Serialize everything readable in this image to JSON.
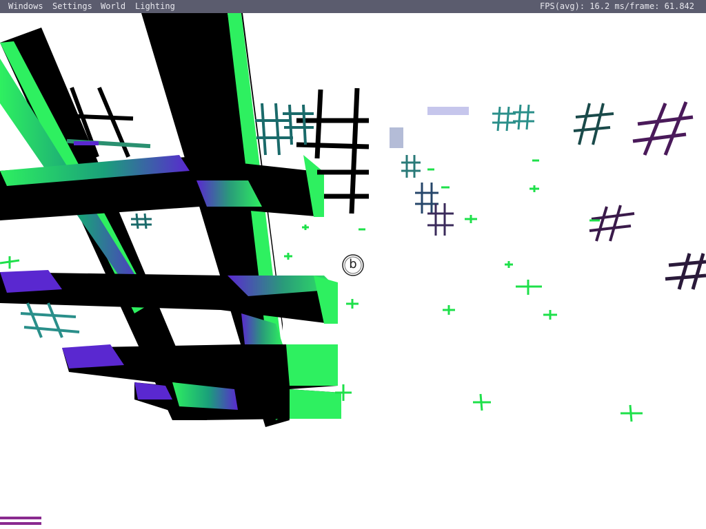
{
  "menubar": {
    "items": [
      {
        "label": "Windows"
      },
      {
        "label": "Settings"
      },
      {
        "label": "World"
      },
      {
        "label": "Lighting"
      }
    ],
    "fps_text": "FPS(avg): 16.2 ms/frame: 61.842"
  },
  "scene": {
    "marker_label": "b",
    "colors": {
      "background": "#ffffff",
      "menubar": "#5b5c6e",
      "green": "#2ef060",
      "purple": "#5a28d0",
      "teal": "#2a8f8a",
      "magenta": "#8a2a8f"
    }
  }
}
